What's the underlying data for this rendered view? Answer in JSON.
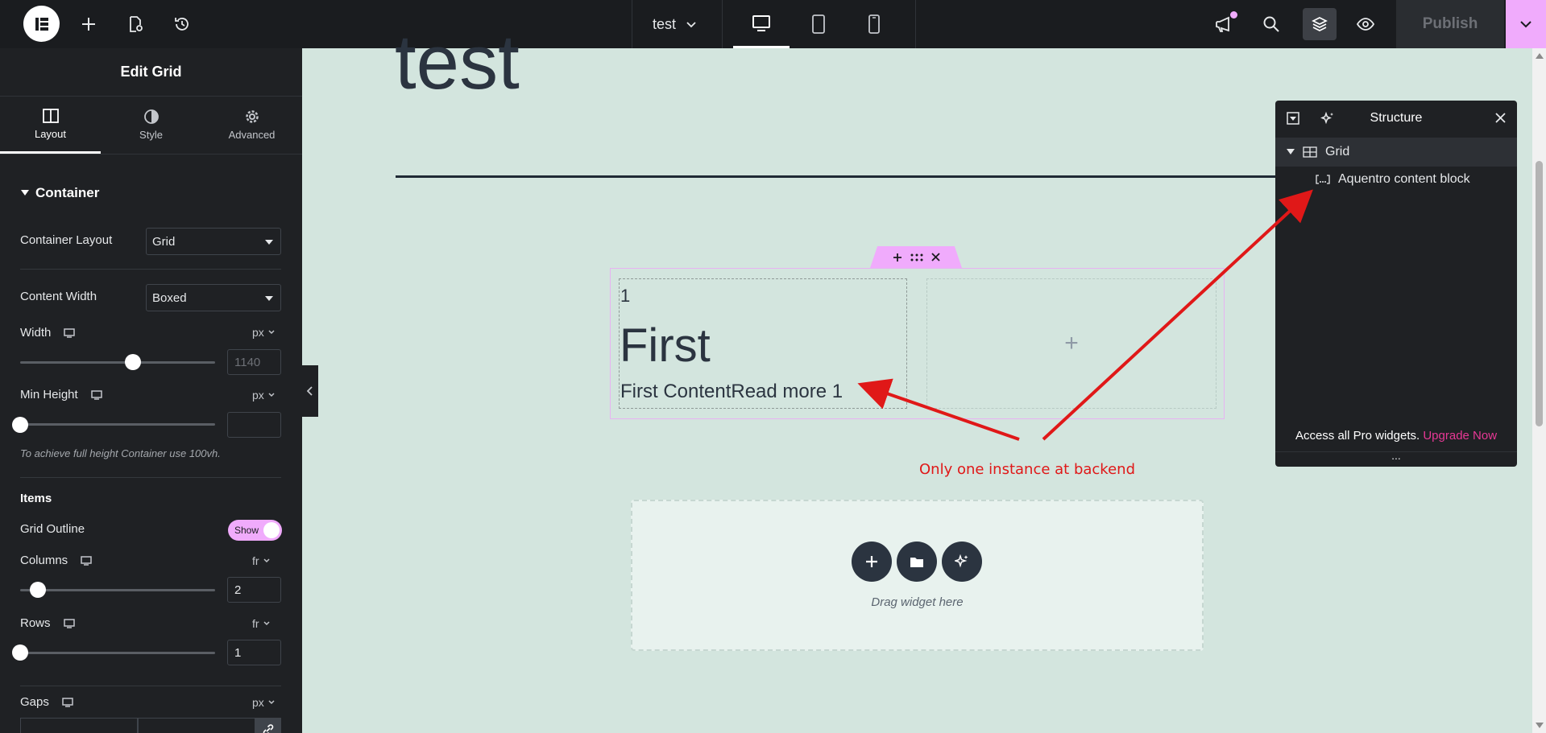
{
  "topbar": {
    "document_title": "test",
    "publish_label": "Publish",
    "icons": [
      "elementor-logo-icon",
      "add-element-icon",
      "page-settings-icon",
      "history-icon",
      "desktop-icon",
      "tablet-icon",
      "mobile-icon",
      "whats-new-icon",
      "search-icon",
      "structure-layers-icon",
      "preview-eye-icon",
      "chevron-down-icon"
    ]
  },
  "panel": {
    "title": "Edit Grid",
    "tabs": [
      {
        "label": "Layout",
        "active": true
      },
      {
        "label": "Style",
        "active": false
      },
      {
        "label": "Advanced",
        "active": false
      }
    ],
    "section_title": "Container",
    "container_layout": {
      "label": "Container Layout",
      "value": "Grid"
    },
    "content_width": {
      "label": "Content Width",
      "value": "Boxed"
    },
    "width": {
      "label": "Width",
      "unit": "px",
      "placeholder": "1140",
      "slider_fraction": 0.5
    },
    "min_height": {
      "label": "Min Height",
      "unit": "px",
      "value": "",
      "slider_fraction": 0
    },
    "note": "To achieve full height Container use 100vh.",
    "items_title": "Items",
    "grid_outline": {
      "label": "Grid Outline",
      "toggle_label": "Show",
      "on": true
    },
    "columns": {
      "label": "Columns",
      "unit": "fr",
      "value": "2",
      "slider_fraction": 0.08
    },
    "rows": {
      "label": "Rows",
      "unit": "fr",
      "value": "1",
      "slider_fraction": 0
    },
    "gaps": {
      "label": "Gaps",
      "unit": "px"
    }
  },
  "canvas": {
    "heading": "test",
    "cell": {
      "number": "1",
      "title": "First",
      "content": "First ContentRead more 1"
    },
    "empty_cell_symbol": "+",
    "annotation": "Only one instance at backend",
    "drop_zone_label": "Drag widget here"
  },
  "structure": {
    "title": "Structure",
    "tree": [
      {
        "label": "Grid",
        "expanded": true
      },
      {
        "label": "Aquentro content block"
      }
    ],
    "footer_text": "Access all Pro widgets.",
    "upgrade_link": "Upgrade Now",
    "more": "..."
  },
  "colors": {
    "accent_pink": "#f0abfc",
    "canvas_bg": "#d3e5de",
    "panel_bg": "#1f2124",
    "annotation_red": "#e01818",
    "upgrade_link": "#e73895"
  }
}
